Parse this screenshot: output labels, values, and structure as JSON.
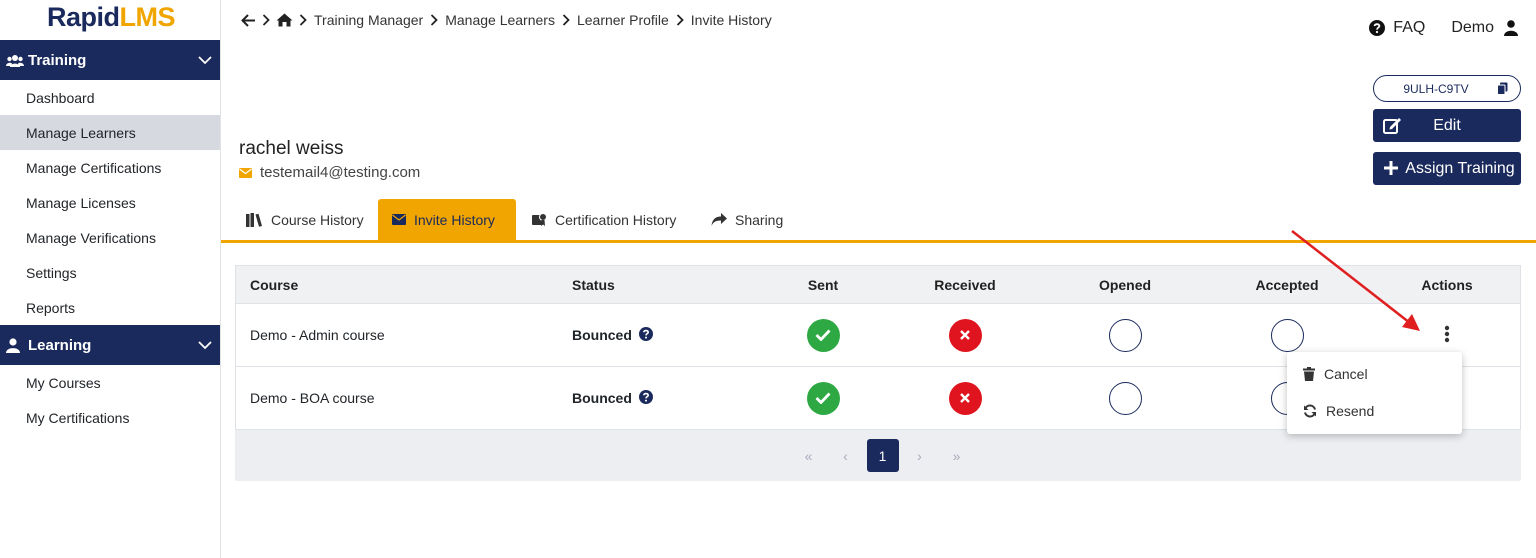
{
  "logo": {
    "part1": "Rapid",
    "part2": "LMS"
  },
  "sidebar": {
    "training": {
      "label": "Training",
      "items": [
        "Dashboard",
        "Manage Learners",
        "Manage Certifications",
        "Manage Licenses",
        "Manage Verifications",
        "Settings",
        "Reports"
      ]
    },
    "learning": {
      "label": "Learning",
      "items": [
        "My Courses",
        "My Certifications"
      ]
    }
  },
  "breadcrumb": [
    "Training Manager",
    "Manage Learners",
    "Learner Profile",
    "Invite History"
  ],
  "header": {
    "faq": "FAQ",
    "user": "Demo"
  },
  "profile": {
    "code": "9ULH-C9TV",
    "edit": "Edit",
    "assign": "Assign Training",
    "name": "rachel weiss",
    "email": "testemail4@testing.com"
  },
  "tabs": [
    "Course History",
    "Invite History",
    "Certification History",
    "Sharing"
  ],
  "table": {
    "headers": [
      "Course",
      "Status",
      "Sent",
      "Received",
      "Opened",
      "Accepted",
      "Actions"
    ],
    "rows": [
      {
        "course": "Demo - Admin course",
        "status": "Bounced",
        "sent": "ok",
        "received": "bad",
        "opened": "empty",
        "accepted": "empty"
      },
      {
        "course": "Demo - BOA course",
        "status": "Bounced",
        "sent": "ok",
        "received": "bad",
        "opened": "empty",
        "accepted": "empty"
      }
    ]
  },
  "pagination": {
    "first": "«",
    "prev": "‹",
    "current": "1",
    "next": "›",
    "last": "»"
  },
  "menu": {
    "cancel": "Cancel",
    "resend": "Resend"
  },
  "colors": {
    "navy": "#1b2a5c",
    "accent": "#f0a500",
    "success": "#2ea843",
    "danger": "#e0141e",
    "annotation": "#e02020"
  }
}
